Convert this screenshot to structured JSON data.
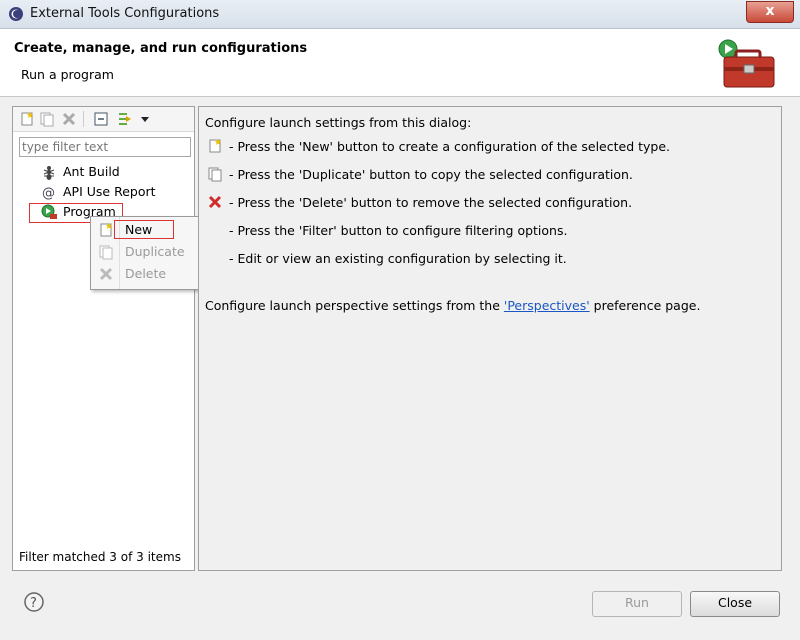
{
  "window": {
    "title": "External Tools Configurations",
    "close_label": "x"
  },
  "header": {
    "title": "Create, manage, and run configurations",
    "subtitle": "Run a program"
  },
  "left": {
    "filter_placeholder": "type filter text",
    "items": [
      {
        "label": "Ant Build"
      },
      {
        "label": "API Use Report"
      },
      {
        "label": "Program"
      }
    ],
    "matched": "Filter matched 3 of 3 items"
  },
  "context_menu": {
    "items": [
      {
        "label": "New"
      },
      {
        "label": "Duplicate"
      },
      {
        "label": "Delete"
      }
    ]
  },
  "right": {
    "intro": "Configure launch settings from this dialog:",
    "lines": [
      "- Press the 'New' button to create a configuration of the selected type.",
      "- Press the 'Duplicate' button to copy the selected configuration.",
      "- Press the 'Delete' button to remove the selected configuration.",
      "- Press the 'Filter' button to configure filtering options.",
      "- Edit or view an existing configuration by selecting it."
    ],
    "perspective_prefix": "Configure launch perspective settings from the ",
    "perspective_link": "'Perspectives'",
    "perspective_suffix": " preference page."
  },
  "buttons": {
    "run": "Run",
    "close": "Close"
  },
  "colors": {
    "highlight_border": "#dd3333",
    "link": "#1a56c4"
  }
}
